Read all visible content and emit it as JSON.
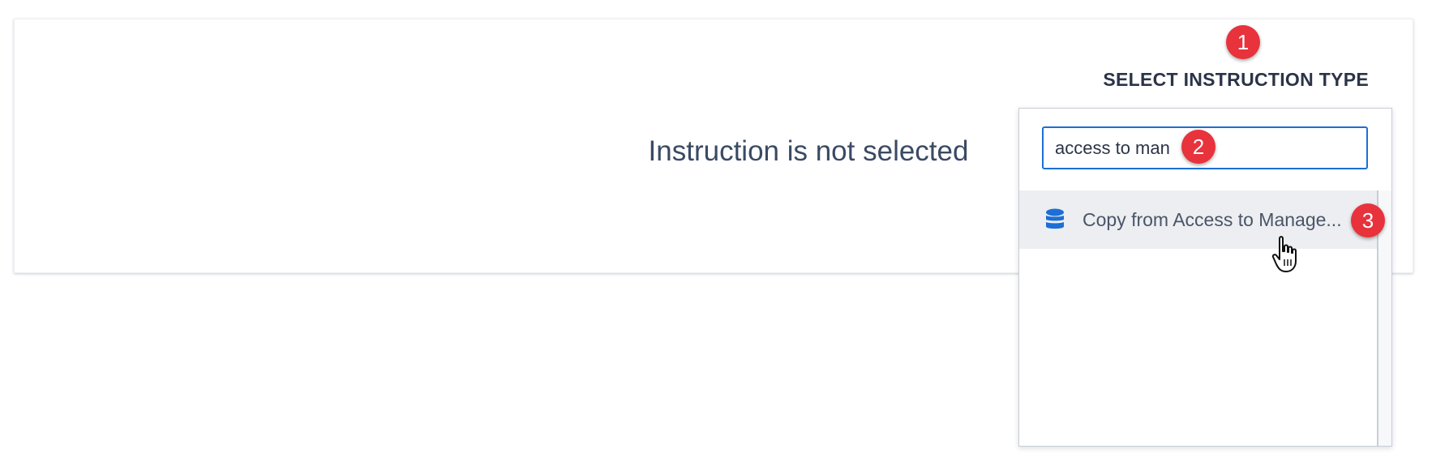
{
  "main": {
    "empty_message": "Instruction is not selected"
  },
  "selector": {
    "title": "SELECT INSTRUCTION TYPE",
    "search_value": "access to man",
    "results": [
      {
        "label": "Copy from Access to Manage...",
        "icon": "database-icon"
      }
    ]
  },
  "annotations": {
    "step1": "1",
    "step2": "2",
    "step3": "3"
  },
  "colors": {
    "accent": "#1c6fd6",
    "badge": "#e8323c",
    "highlight": "#eceef1"
  }
}
